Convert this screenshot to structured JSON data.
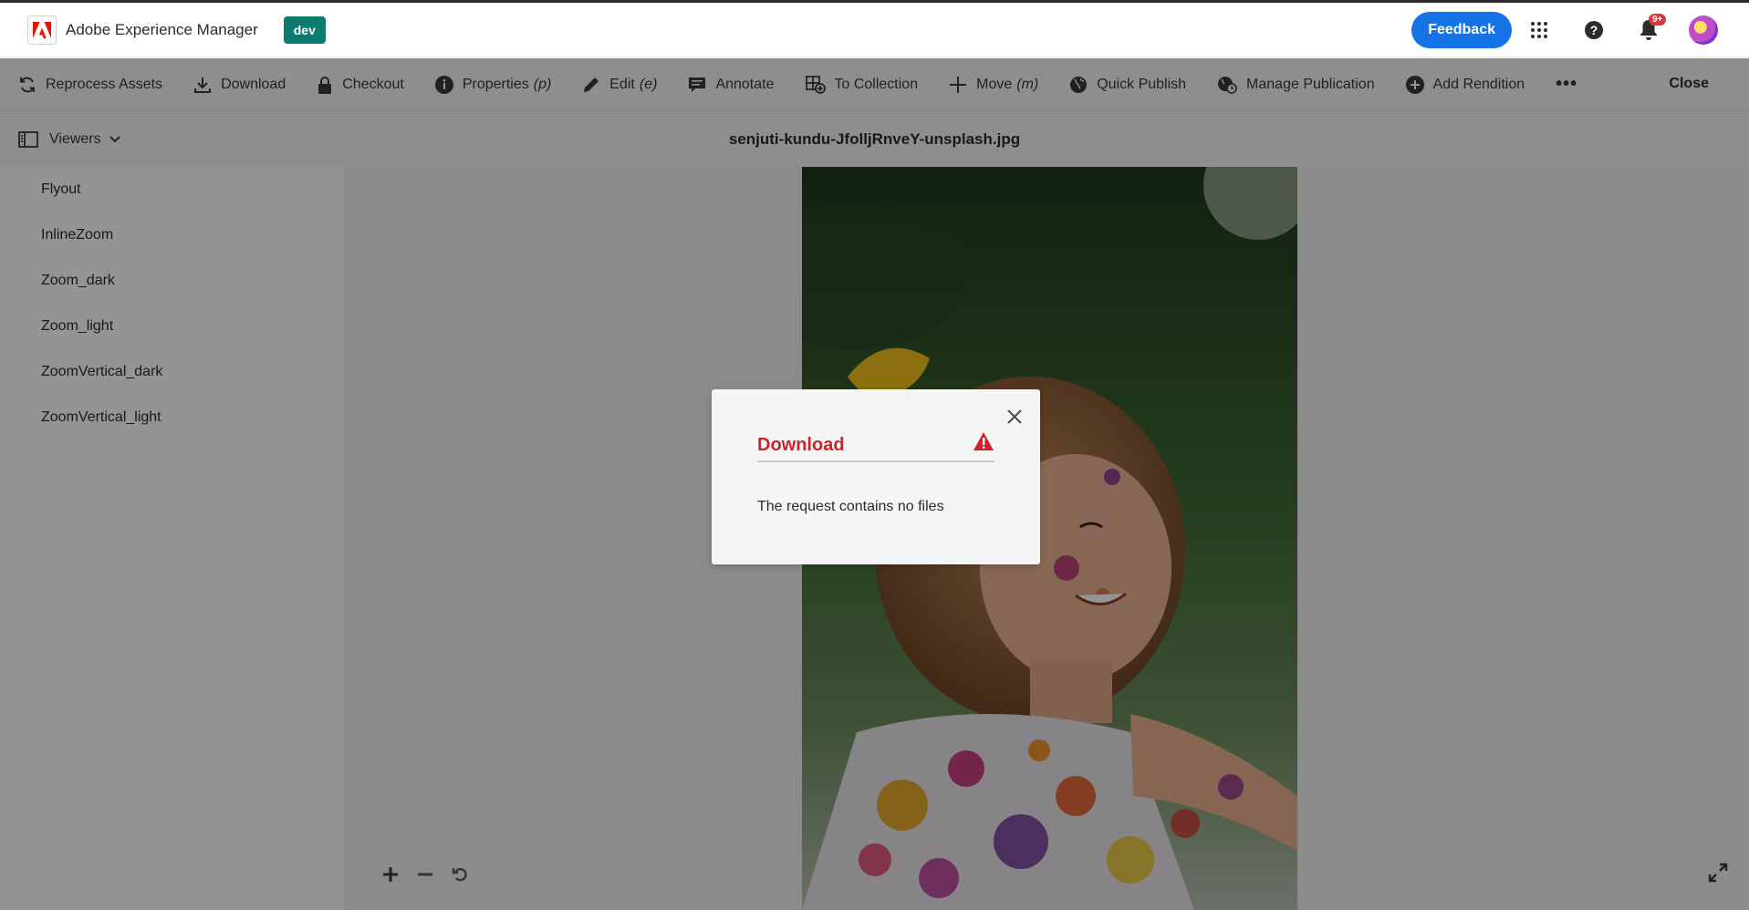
{
  "header": {
    "app_title": "Adobe Experience Manager",
    "env_badge": "dev",
    "feedback_label": "Feedback",
    "notification_count": "9+"
  },
  "actions": {
    "reprocess": "Reprocess Assets",
    "download": "Download",
    "checkout": "Checkout",
    "properties": "Properties",
    "properties_shortcut": "(p)",
    "edit": "Edit",
    "edit_shortcut": "(e)",
    "annotate": "Annotate",
    "to_collection": "To Collection",
    "move": "Move",
    "move_shortcut": "(m)",
    "quick_publish": "Quick Publish",
    "manage_publication": "Manage Publication",
    "add_rendition": "Add Rendition",
    "more": "•••",
    "close": "Close"
  },
  "titlebar": {
    "viewers_label": "Viewers",
    "asset_name": "senjuti-kundu-JfolljRnveY-unsplash.jpg"
  },
  "sidebar": {
    "viewers": [
      "Flyout",
      "InlineZoom",
      "Zoom_dark",
      "Zoom_light",
      "ZoomVertical_dark",
      "ZoomVertical_light"
    ]
  },
  "dialog": {
    "title": "Download",
    "message": "The request contains no files"
  },
  "colors": {
    "accent": "#1473e6",
    "env_badge": "#0b7b6f",
    "error": "#c9252c"
  }
}
